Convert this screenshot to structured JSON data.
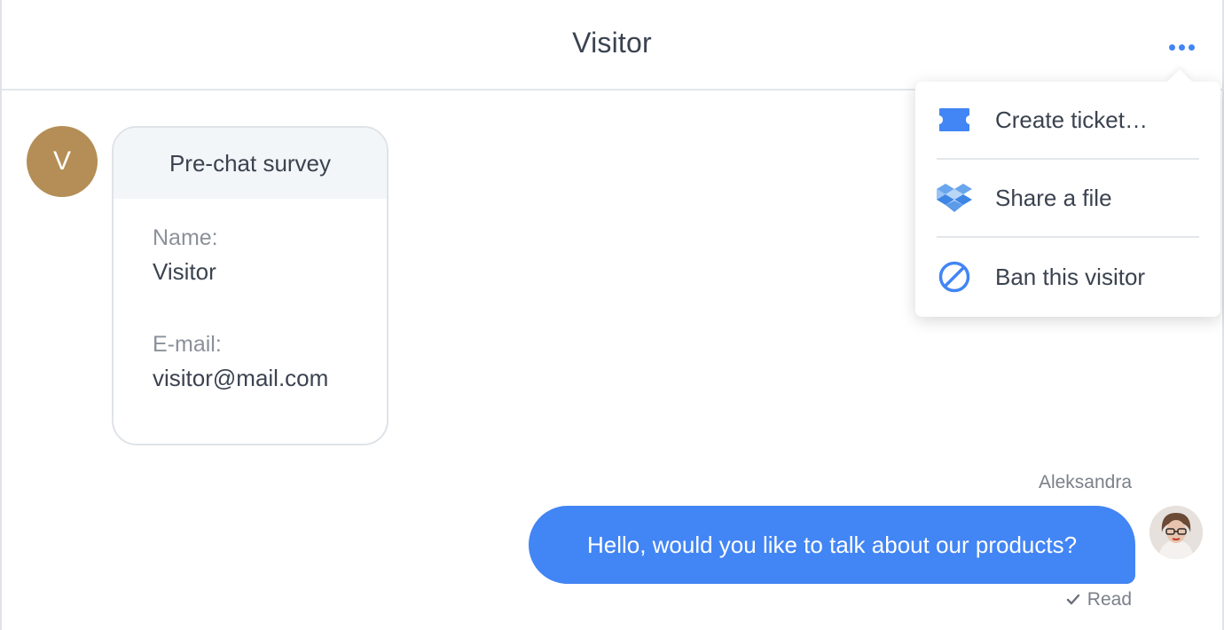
{
  "header": {
    "title": "Visitor",
    "more_icon": "more-horizontal-icon"
  },
  "menu": {
    "items": [
      {
        "label": "Create ticket…",
        "icon": "ticket-icon"
      },
      {
        "label": "Share a file",
        "icon": "dropbox-icon"
      },
      {
        "label": "Ban this visitor",
        "icon": "ban-icon"
      }
    ]
  },
  "visitor": {
    "avatar_initial": "V",
    "survey": {
      "title": "Pre-chat survey",
      "fields": [
        {
          "label": "Name:",
          "value": "Visitor"
        },
        {
          "label": "E-mail:",
          "value": "visitor@mail.com"
        }
      ]
    }
  },
  "agent": {
    "name": "Aleksandra",
    "message": "Hello, would you like to talk about our products?",
    "status": "Read"
  },
  "colors": {
    "accent": "#4285f4",
    "visitor_avatar": "#b48e56",
    "text": "#3b4350",
    "muted": "#8b919a"
  }
}
